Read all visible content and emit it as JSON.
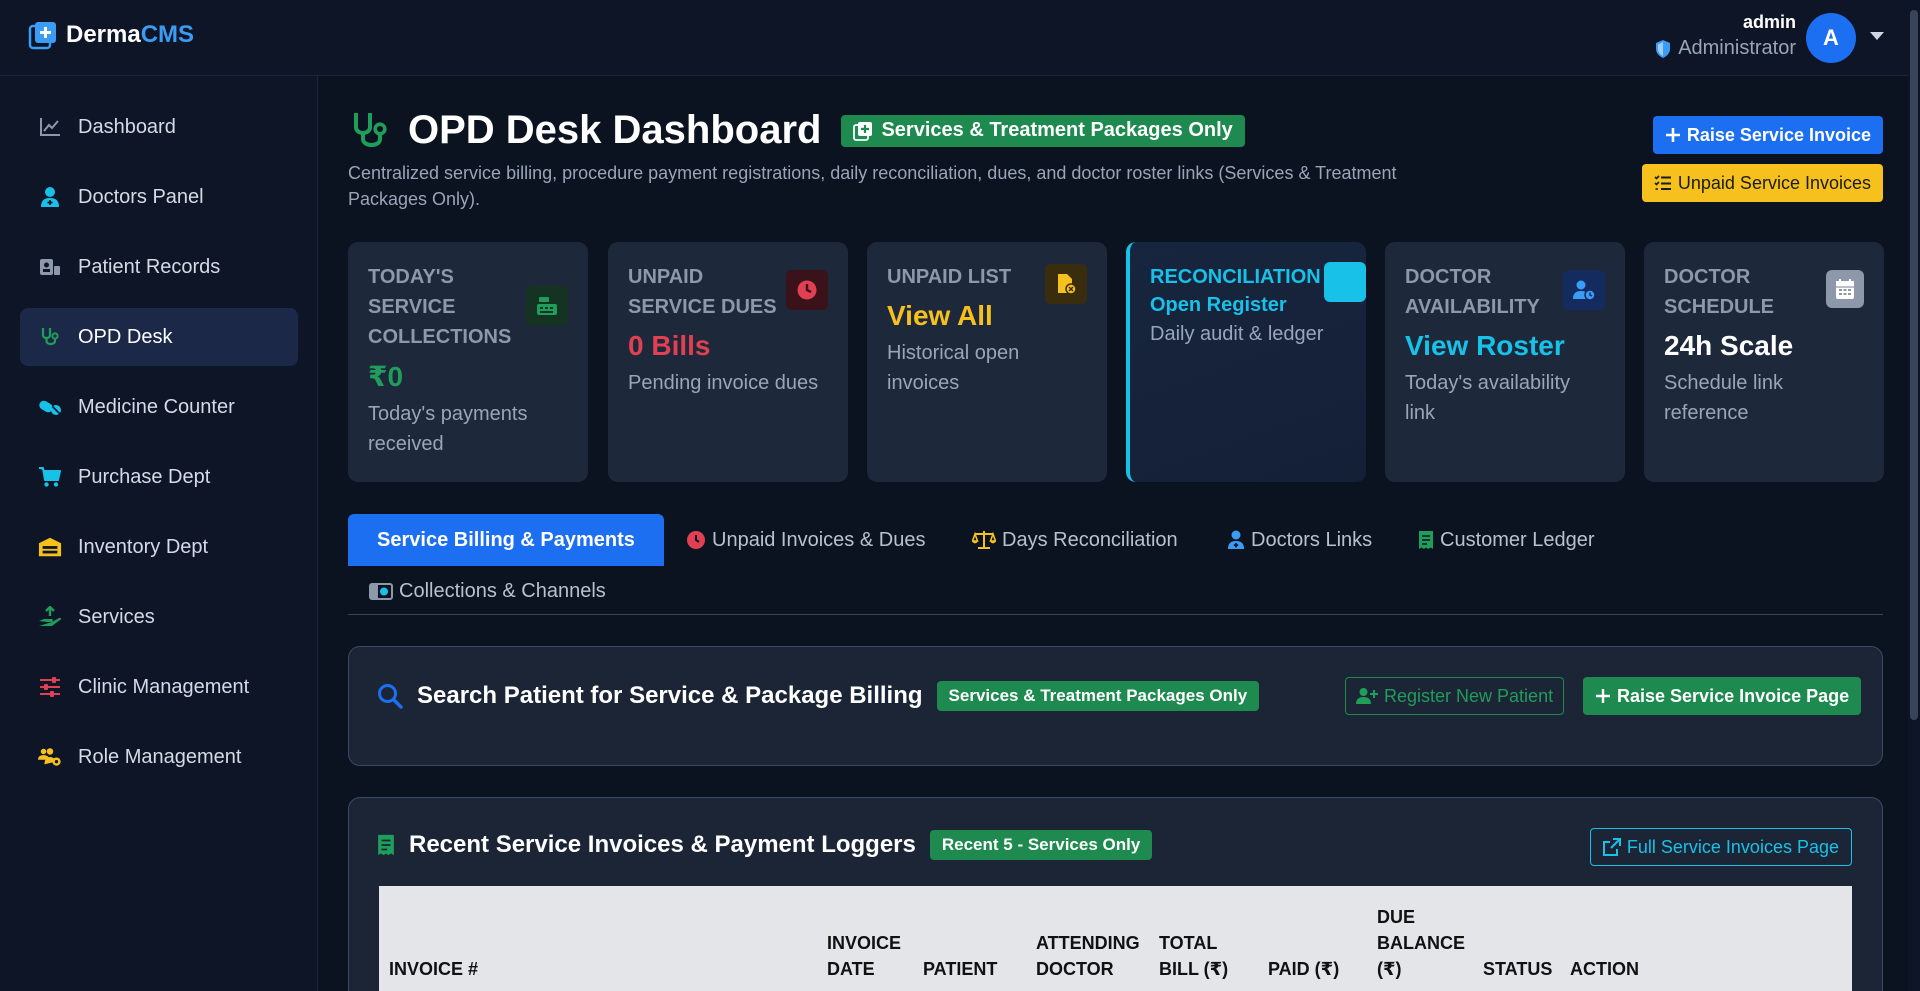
{
  "app": {
    "brand_main": "Derma",
    "brand_accent": "CMS"
  },
  "user": {
    "name": "admin",
    "role": "Administrator",
    "avatar_initial": "A"
  },
  "sidebar": {
    "items": [
      {
        "label": "Dashboard",
        "icon": "chart-line-icon"
      },
      {
        "label": "Doctors Panel",
        "icon": "user-doctor-icon"
      },
      {
        "label": "Patient Records",
        "icon": "id-card-icon"
      },
      {
        "label": "OPD Desk",
        "icon": "stethoscope-icon",
        "active": true
      },
      {
        "label": "Medicine Counter",
        "icon": "pills-icon"
      },
      {
        "label": "Purchase Dept",
        "icon": "cart-icon"
      },
      {
        "label": "Inventory Dept",
        "icon": "warehouse-icon"
      },
      {
        "label": "Services",
        "icon": "hand-holding-icon"
      },
      {
        "label": "Clinic Management",
        "icon": "sliders-icon"
      },
      {
        "label": "Role Management",
        "icon": "users-gear-icon"
      }
    ]
  },
  "header": {
    "title": "OPD Desk Dashboard",
    "badge": "Services & Treatment Packages Only",
    "subtitle": "Centralized service billing, procedure payment registrations, daily reconciliation, dues, and doctor roster links (Services & Treatment Packages Only).",
    "raise_button": "Raise Service Invoice",
    "unpaid_button": "Unpaid Service Invoices"
  },
  "cards": [
    {
      "title": "Today's Service Collections",
      "value": "₹0",
      "sub": "Today's payments received",
      "value_color": "#1f9d5b",
      "icon": "cash-register-icon"
    },
    {
      "title": "Unpaid Service Dues",
      "value": "0 Bills",
      "sub": "Pending invoice dues",
      "value_color": "#e04052",
      "icon": "clock-icon"
    },
    {
      "title": "Unpaid List",
      "value": "View All",
      "sub": "Historical open invoices",
      "value_color": "#f6c11c",
      "icon": "file-invoice-icon"
    },
    {
      "title": "Reconciliation",
      "value": "Open Register",
      "sub": "Daily audit & ledger",
      "value_color": "#17c1e8",
      "icon": "scale-icon"
    },
    {
      "title": "Doctor Availability",
      "value": "View Roster",
      "sub": "Today's availability link",
      "value_color": "#17c1e8",
      "icon": "user-clock-icon"
    },
    {
      "title": "Doctor Schedule",
      "value": "24h Scale",
      "sub": "Schedule link reference",
      "value_color": "#ffffff",
      "icon": "calendar-icon"
    }
  ],
  "tabs": [
    {
      "label": "Service Billing & Payments",
      "active": true
    },
    {
      "label": "Unpaid Invoices & Dues",
      "icon": "clock-icon"
    },
    {
      "label": "Days Reconciliation",
      "icon": "scale-icon"
    },
    {
      "label": "Doctors Links",
      "icon": "user-doctor-icon"
    },
    {
      "label": "Customer Ledger",
      "icon": "receipt-icon"
    },
    {
      "label": "Collections & Channels",
      "icon": "money-icon"
    }
  ],
  "search_panel": {
    "title": "Search Patient for Service & Package Billing",
    "badge": "Services & Treatment Packages Only",
    "register_button": "Register New Patient",
    "raise_page_button": "Raise Service Invoice Page"
  },
  "invoices_panel": {
    "title": "Recent Service Invoices & Payment Loggers",
    "badge": "Recent 5 - Services Only",
    "full_page_button": "Full Service Invoices Page",
    "columns": [
      "Invoice #",
      "Invoice Date",
      "Patient",
      "Attending Doctor",
      "Total Bill (₹)",
      "Paid (₹)",
      "Due Balance (₹)",
      "Status",
      "Action"
    ]
  },
  "colors": {
    "primary": "#1d6ff2",
    "success": "#1e8a4f",
    "warning": "#f6c11c",
    "danger": "#e04052",
    "info": "#17c1e8"
  }
}
